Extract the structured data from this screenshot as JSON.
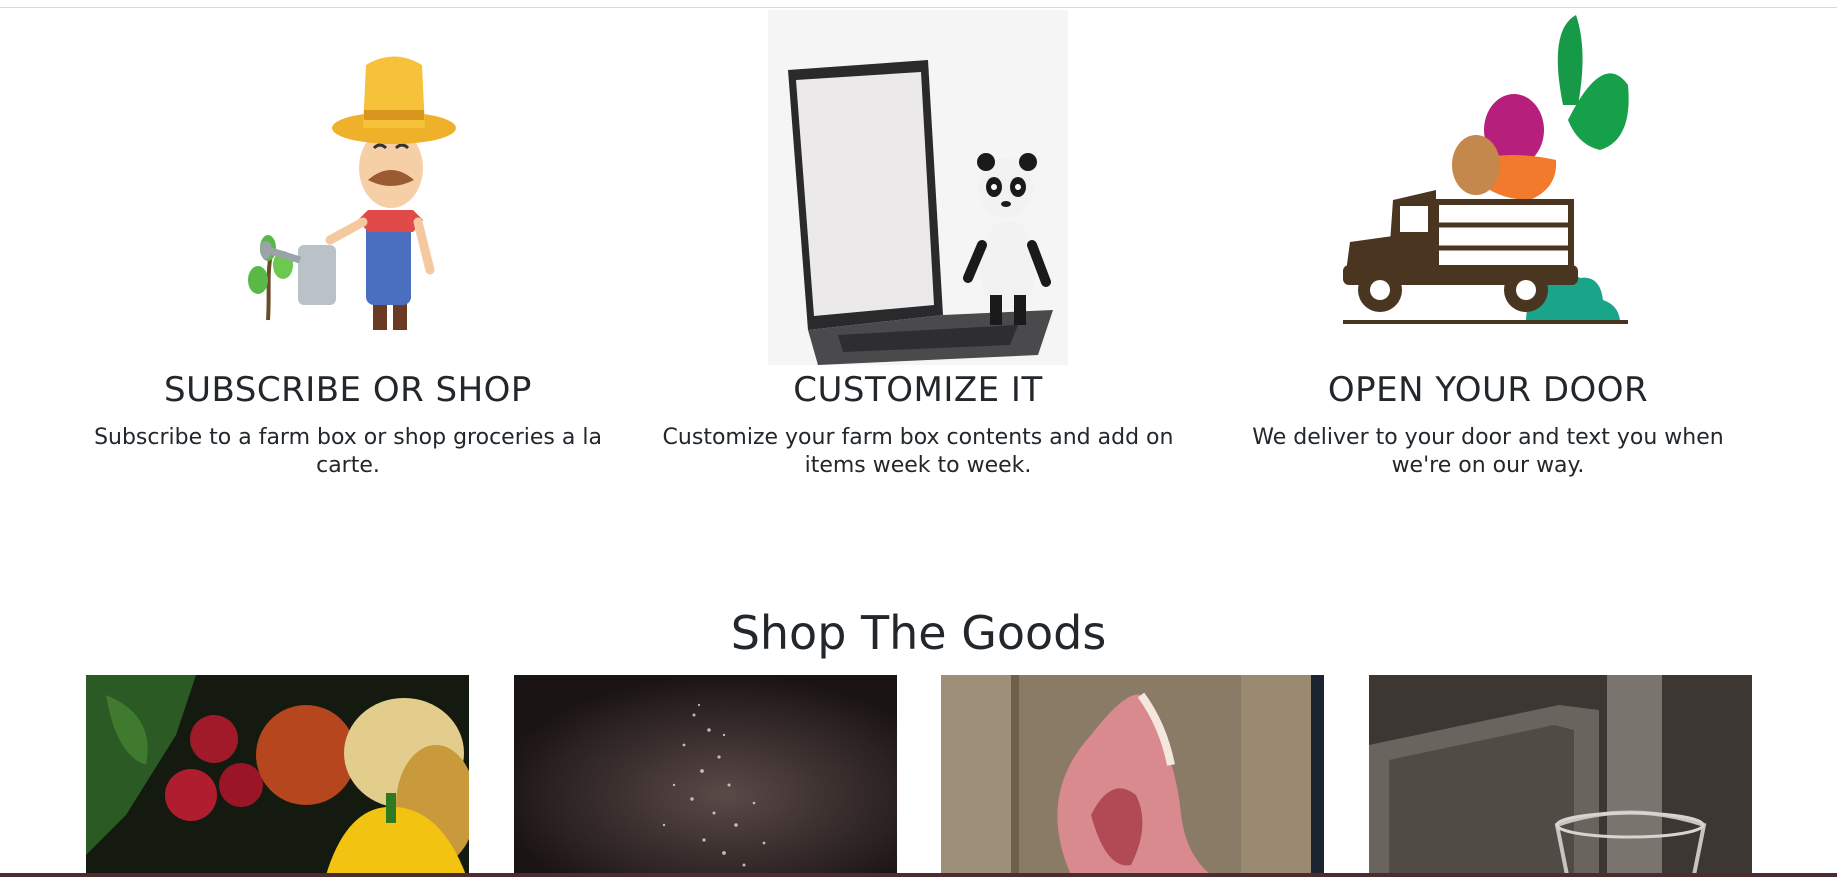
{
  "steps": [
    {
      "title": "SUBSCRIBE OR SHOP",
      "description": "Subscribe to a farm box or shop groceries a la carte.",
      "illustration": "farmer-watering-plant"
    },
    {
      "title": "CUSTOMIZE IT",
      "description": "Customize your farm box contents and add on items week to week.",
      "illustration": "laptop-with-panda"
    },
    {
      "title": "OPEN YOUR DOOR",
      "description": "We deliver to your door and text you when we're on our way.",
      "illustration": "vegetable-delivery-truck"
    }
  ],
  "shop": {
    "title": "Shop The Goods",
    "categories": [
      {
        "image": "radishes-potatoes-pepper-photo"
      },
      {
        "image": "falling-salt-photo"
      },
      {
        "image": "raw-meat-on-board-photo"
      },
      {
        "image": "glass-and-wooden-box-photo"
      }
    ]
  },
  "colors": {
    "text": "#22272b",
    "truck": "#4a3520",
    "leaf_green": "#1a9a4a",
    "beet": "#b7207a",
    "carrot": "#f27a2c",
    "farmer_hat": "#f3b92f"
  }
}
